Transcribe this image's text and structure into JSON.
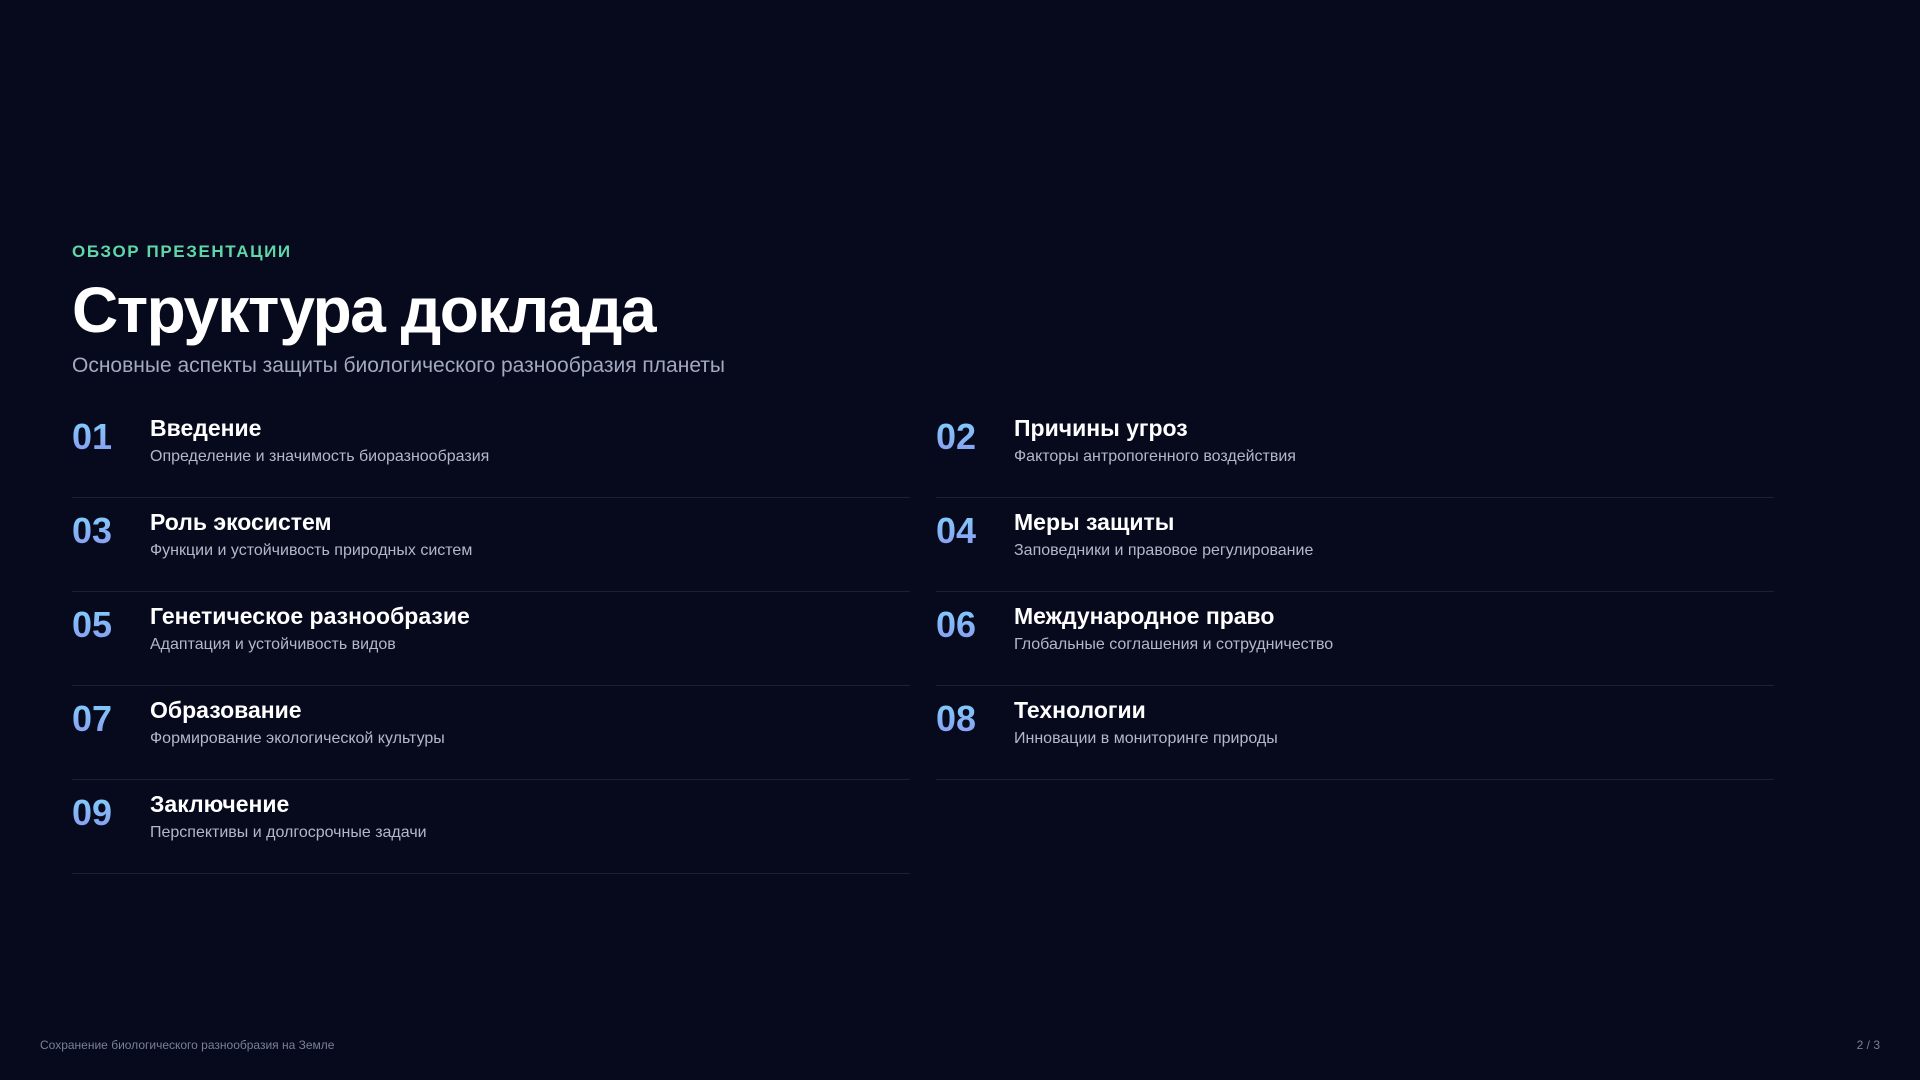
{
  "header": {
    "eyebrow": "ОБЗОР ПРЕЗЕНТАЦИИ",
    "title": "Структура доклада",
    "subtitle": "Основные аспекты защиты биологического разнообразия планеты"
  },
  "items": [
    {
      "number": "01",
      "title": "Введение",
      "description": "Определение и значимость биоразнообразия"
    },
    {
      "number": "02",
      "title": "Причины угроз",
      "description": "Факторы антропогенного воздействия"
    },
    {
      "number": "03",
      "title": "Роль экосистем",
      "description": "Функции и устойчивость природных систем"
    },
    {
      "number": "04",
      "title": "Меры защиты",
      "description": "Заповедники и правовое регулирование"
    },
    {
      "number": "05",
      "title": "Генетическое разнообразие",
      "description": "Адаптация и устойчивость видов"
    },
    {
      "number": "06",
      "title": "Международное право",
      "description": "Глобальные соглашения и сотрудничество"
    },
    {
      "number": "07",
      "title": "Образование",
      "description": "Формирование экологической культуры"
    },
    {
      "number": "08",
      "title": "Технологии",
      "description": "Инновации в мониторинге природы"
    },
    {
      "number": "09",
      "title": "Заключение",
      "description": "Перспективы и долгосрочные задачи"
    }
  ],
  "footer": {
    "presentation_title": "Сохранение биологического разнообразия на Земле",
    "page_indicator": "2 / 3"
  },
  "colors": {
    "background": "#060a1c",
    "accent": "#5fd7a8",
    "number_gradient_start": "#7fd6ff",
    "number_gradient_end": "#8b93ee"
  }
}
